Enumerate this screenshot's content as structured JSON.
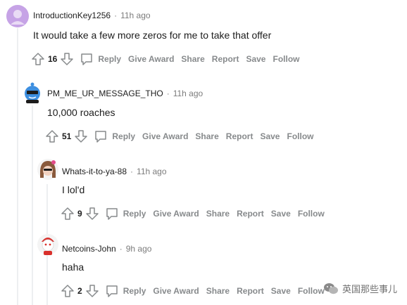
{
  "comments": [
    {
      "username": "IntroductionKey1256",
      "dot": "·",
      "time": "11h ago",
      "text": "It would take a few more zeros for me to take that offer",
      "score": "16",
      "actions": {
        "reply": "Reply",
        "give_award": "Give Award",
        "share": "Share",
        "report": "Report",
        "save": "Save",
        "follow": "Follow"
      },
      "avatar_color": "#c6a3e6"
    },
    {
      "username": "PM_ME_UR_MESSAGE_THO",
      "dot": "·",
      "time": "11h ago",
      "text": "10,000 roaches",
      "score": "51",
      "actions": {
        "reply": "Reply",
        "give_award": "Give Award",
        "share": "Share",
        "report": "Report",
        "save": "Save",
        "follow": "Follow"
      },
      "avatar_color": "#3d8fe0"
    },
    {
      "username": "Whats-it-to-ya-88",
      "dot": "·",
      "time": "11h ago",
      "text": "I lol'd",
      "score": "9",
      "actions": {
        "reply": "Reply",
        "give_award": "Give Award",
        "share": "Share",
        "report": "Report",
        "save": "Save",
        "follow": "Follow"
      },
      "avatar_color": "#8a5a3c"
    },
    {
      "username": "Netcoins-John",
      "dot": "·",
      "time": "9h ago",
      "text": "haha",
      "score": "2",
      "actions": {
        "reply": "Reply",
        "give_award": "Give Award",
        "share": "Share",
        "report": "Report",
        "save": "Save",
        "follow": "Follow"
      },
      "avatar_color": "#d9302c"
    }
  ],
  "watermark": {
    "text": "英国那些事儿",
    "icon": "wechat-icon"
  }
}
